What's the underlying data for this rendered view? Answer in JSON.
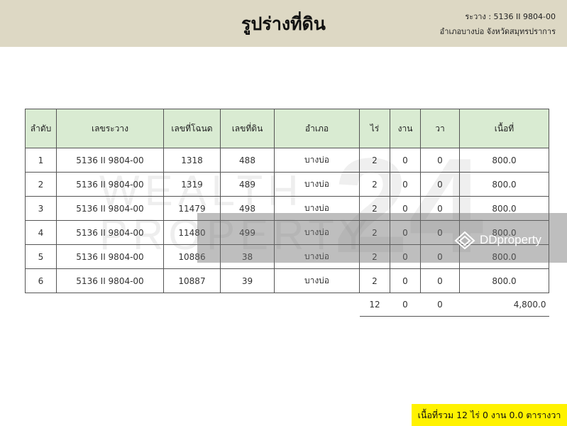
{
  "header": {
    "title": "รูปร่างที่ดิน",
    "grid_line": "ระวาง : 5136 II 9804-00",
    "location_line": "อำเภอบางบ่อ จังหวัดสมุทรปราการ"
  },
  "watermark": {
    "line1": "WEALTH",
    "line2": "PROPERTY",
    "number": "24",
    "brand": "DDproperty"
  },
  "table": {
    "headers": [
      "ลำดับ",
      "เลขระวาง",
      "เลขที่โฉนด",
      "เลขที่ดิน",
      "อำเภอ",
      "ไร่",
      "งาน",
      "วา",
      "เนื้อที่"
    ],
    "rows": [
      {
        "no": "1",
        "grid": "5136 II 9804-00",
        "deed": "1318",
        "land_no": "488",
        "district": "บางบ่อ",
        "rai": "2",
        "ngan": "0",
        "wa": "0",
        "area": "800.0"
      },
      {
        "no": "2",
        "grid": "5136 II 9804-00",
        "deed": "1319",
        "land_no": "489",
        "district": "บางบ่อ",
        "rai": "2",
        "ngan": "0",
        "wa": "0",
        "area": "800.0"
      },
      {
        "no": "3",
        "grid": "5136 II 9804-00",
        "deed": "11479",
        "land_no": "498",
        "district": "บางบ่อ",
        "rai": "2",
        "ngan": "0",
        "wa": "0",
        "area": "800.0"
      },
      {
        "no": "4",
        "grid": "5136 II 9804-00",
        "deed": "11480",
        "land_no": "499",
        "district": "บางบ่อ",
        "rai": "2",
        "ngan": "0",
        "wa": "0",
        "area": "800.0"
      },
      {
        "no": "5",
        "grid": "5136 II 9804-00",
        "deed": "10886",
        "land_no": "38",
        "district": "บางบ่อ",
        "rai": "2",
        "ngan": "0",
        "wa": "0",
        "area": "800.0"
      },
      {
        "no": "6",
        "grid": "5136 II 9804-00",
        "deed": "10887",
        "land_no": "39",
        "district": "บางบ่อ",
        "rai": "2",
        "ngan": "0",
        "wa": "0",
        "area": "800.0"
      }
    ],
    "totals": {
      "rai": "12",
      "ngan": "0",
      "wa": "0",
      "area": "4,800.0"
    }
  },
  "summary": "เนื้อที่รวม 12 ไร่ 0 งาน 0.0 ตารางวา",
  "colors": {
    "header_bg": "#ddd8c4",
    "table_header_bg": "#d9ebd2",
    "summary_bg": "#fff200"
  }
}
